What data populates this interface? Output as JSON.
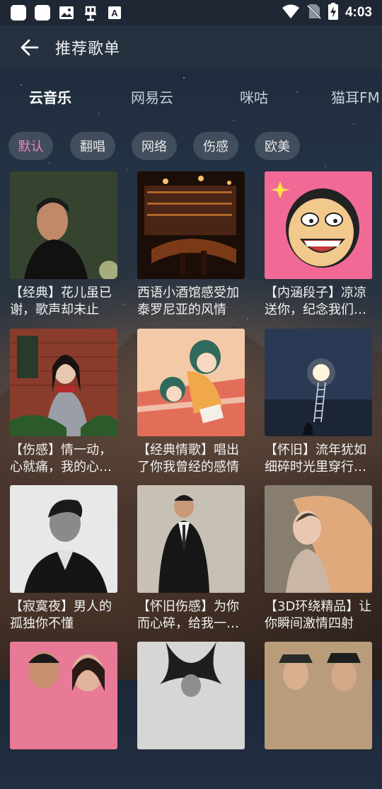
{
  "status_bar": {
    "time": "4:03",
    "left_icons": [
      "app-icon",
      "app-icon",
      "image-icon",
      "bug-icon",
      "a-box-icon"
    ],
    "right_icons": [
      "wifi-icon",
      "no-sim-icon",
      "battery-charging-icon"
    ]
  },
  "app_bar": {
    "title": "推荐歌单",
    "back_icon": "arrow-left-icon"
  },
  "tabs": [
    {
      "label": "云音乐",
      "active": true
    },
    {
      "label": "网易云",
      "active": false
    },
    {
      "label": "咪咕",
      "active": false
    },
    {
      "label": "猫耳FM",
      "active": false
    }
  ],
  "chips": [
    {
      "label": "默认",
      "selected": true
    },
    {
      "label": "翻唱",
      "selected": false
    },
    {
      "label": "网络",
      "selected": false
    },
    {
      "label": "伤感",
      "selected": false
    },
    {
      "label": "欧美",
      "selected": false
    }
  ],
  "playlists": [
    {
      "title": "【经典】花儿虽已谢，歌声却未止",
      "cover": "man-portrait-dark"
    },
    {
      "title": "西语小酒馆感受加泰罗尼亚的风情",
      "cover": "bar-interior"
    },
    {
      "title": "【内涵段子】凉凉送你，纪念我们…",
      "cover": "cartoon-face"
    },
    {
      "title": "【伤感】情一动，心就痛，我的心…",
      "cover": "woman-winter"
    },
    {
      "title": "【经典情歌】唱出了你我曾经的感情",
      "cover": "illustration-couple"
    },
    {
      "title": "【怀旧】流年犹如细碎时光里穿行…",
      "cover": "moon-ladder"
    },
    {
      "title": "【寂寞夜】男人的孤独你不懂",
      "cover": "man-bw"
    },
    {
      "title": "【怀旧伤感】为你而心碎，给我一…",
      "cover": "man-suit"
    },
    {
      "title": "【3D环绕精品】让你瞬间激情四射",
      "cover": "fantasy-woman"
    },
    {
      "title": "",
      "cover": "couple-pink"
    },
    {
      "title": "",
      "cover": "hair-bw"
    },
    {
      "title": "",
      "cover": "men-hats"
    }
  ]
}
